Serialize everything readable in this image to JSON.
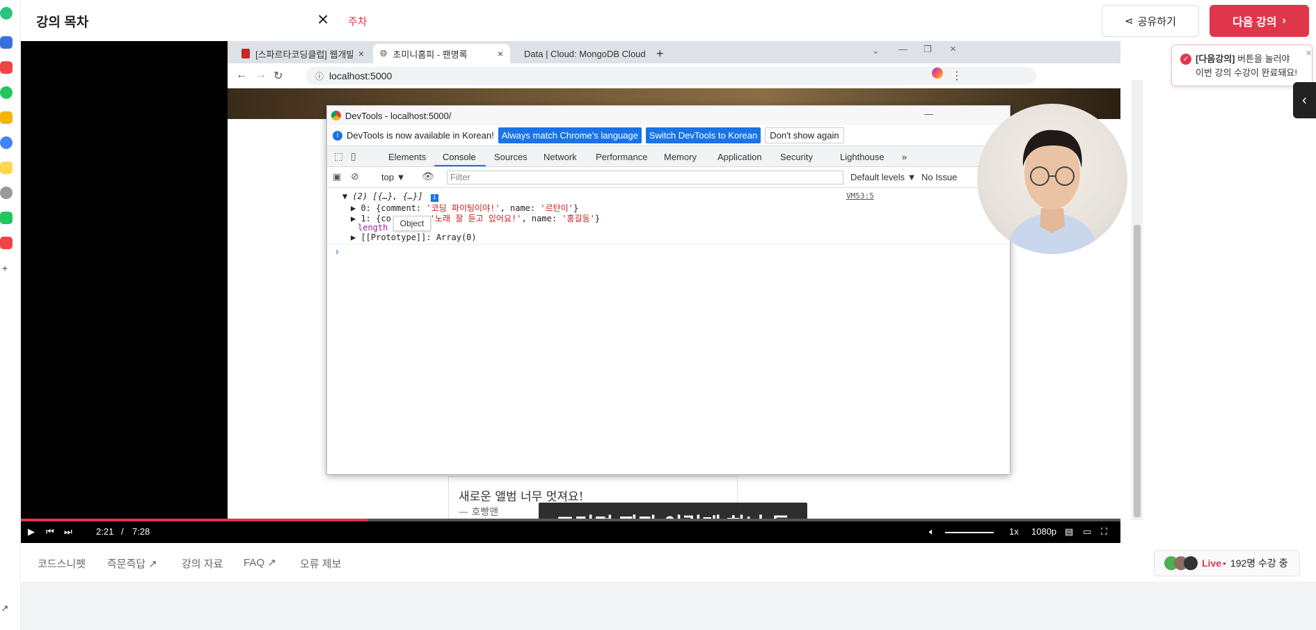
{
  "header": {
    "toc_title": "강의 목차",
    "tag": "주차",
    "share_label": "공유하기",
    "next_label": "다음 강의"
  },
  "browser": {
    "tabs": [
      {
        "label": "[스파르타코딩클럽] 웹개발 종합"
      },
      {
        "label": "초미니홈피 - 팬명록"
      },
      {
        "label": "Data | Cloud: MongoDB Cloud"
      }
    ],
    "new_tab": "+",
    "address": "localhost:5000"
  },
  "devtools": {
    "title": "DevTools - localhost:5000/",
    "info_text": "DevTools is now available in Korean!",
    "btn_match": "Always match Chrome's language",
    "btn_switch": "Switch DevTools to Korean",
    "btn_dont": "Don't show again",
    "tabs": [
      "Elements",
      "Console",
      "Sources",
      "Network",
      "Performance",
      "Memory",
      "Application",
      "Security",
      "Lighthouse",
      "»"
    ],
    "context": "top ▼",
    "filter_placeholder": "Filter",
    "levels": "Default levels ▼",
    "issues": "No Issue",
    "console": {
      "summary": "▼ (2) [{…}, {…}]",
      "source": "VM53:5",
      "row0_prefix": "▶ 0: {comment: ",
      "row0_comment": "'코딩 파이팅이야!'",
      "row0_mid": ", name: ",
      "row0_name": "'르탄이'",
      "row0_end": "}",
      "row1_prefix": "▶ 1: {co",
      "row1_comment": "'노래 잘 듣고 있어요!'",
      "row1_mid": ", name: ",
      "row1_name": "'홍길동'",
      "row1_end": "}",
      "length_label": "length",
      "prototype": "▶ [[Prototype]]: Array(0)",
      "tooltip": "Object",
      "prompt": "›"
    }
  },
  "page_behind": {
    "comment": "새로운 앨범 너무 멋져요!",
    "author": "— 호빵맨"
  },
  "subtitle": "그러면 짜잔 이렇게 하나 둘",
  "player": {
    "current_time": "2:21",
    "separator": "/",
    "duration": "7:28",
    "progress_fraction": 0.315,
    "speed": "1x",
    "quality": "1080p"
  },
  "toast": {
    "bold": "[다음강의]",
    "line1_rest": " 버튼을 눌러야",
    "line2": "이번 강의 수강이 완료돼요!",
    "close": "×"
  },
  "lecture_tabs": [
    "코드스니펫",
    "즉문즉답",
    "강의 자료",
    "FAQ",
    "오류 제보"
  ],
  "live": {
    "label": "Live",
    "dot": "•",
    "count": "192명 수강 중"
  },
  "colors": {
    "accent": "#e0364b",
    "chrome_blue": "#1a73e8"
  }
}
